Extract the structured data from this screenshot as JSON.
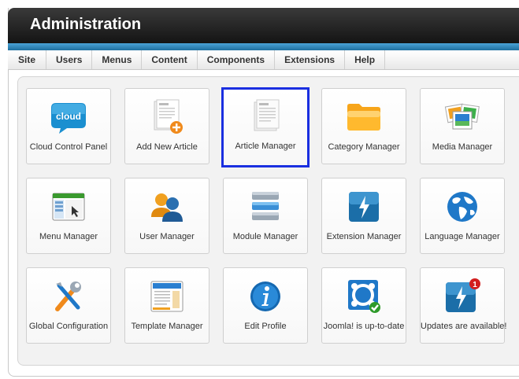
{
  "header": {
    "title": "Administration"
  },
  "menu": [
    "Site",
    "Users",
    "Menus",
    "Content",
    "Components",
    "Extensions",
    "Help"
  ],
  "tiles": [
    {
      "label": "Cloud Control Panel",
      "icon": "cloud-icon",
      "icon_text": "cloud"
    },
    {
      "label": "Add New Article",
      "icon": "add-article-icon"
    },
    {
      "label": "Article Manager",
      "icon": "article-icon",
      "selected": true
    },
    {
      "label": "Category Manager",
      "icon": "folder-icon"
    },
    {
      "label": "Media Manager",
      "icon": "media-icon"
    },
    {
      "label": "Menu Manager",
      "icon": "menu-window-icon"
    },
    {
      "label": "User Manager",
      "icon": "users-icon"
    },
    {
      "label": "Module Manager",
      "icon": "modules-icon"
    },
    {
      "label": "Extension Manager",
      "icon": "extension-bolt-icon"
    },
    {
      "label": "Language Manager",
      "icon": "globe-icon"
    },
    {
      "label": "Global Configuration",
      "icon": "tools-icon"
    },
    {
      "label": "Template Manager",
      "icon": "template-icon"
    },
    {
      "label": "Edit Profile",
      "icon": "info-icon"
    },
    {
      "label": "Joomla! is up-to-date",
      "icon": "joomla-check-icon"
    },
    {
      "label": "Updates are available!",
      "icon": "update-bolt-icon",
      "badge": "1"
    }
  ],
  "colors": {
    "selection_border": "#1a2fe0",
    "header_stripe": "#2b86c0"
  }
}
